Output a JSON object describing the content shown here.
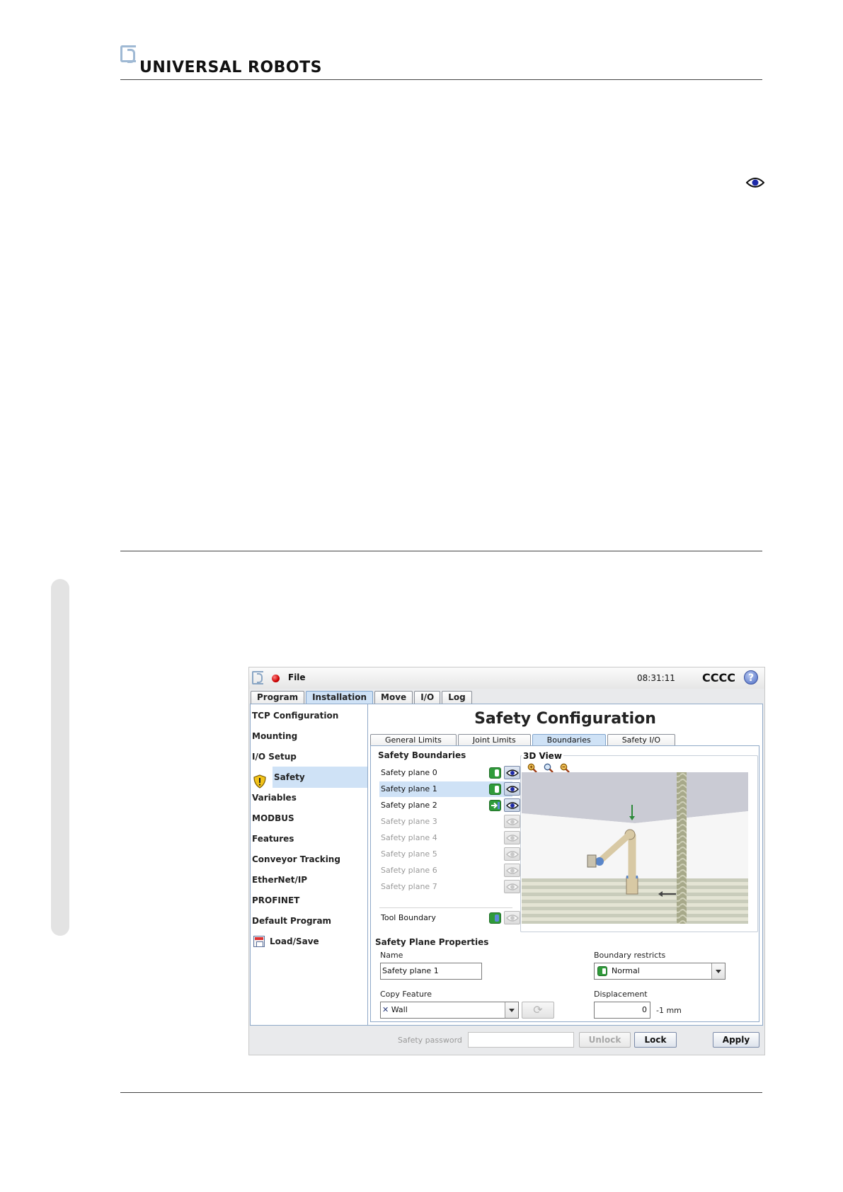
{
  "header": {
    "brand": "UNIVERSAL ROBOTS"
  },
  "app": {
    "menu_file": "File",
    "time": "08:31:11",
    "robot_name": "CCCC",
    "help_glyph": "?",
    "main_tabs": [
      {
        "label": "Program",
        "active": false
      },
      {
        "label": "Installation",
        "active": true
      },
      {
        "label": "Move",
        "active": false
      },
      {
        "label": "I/O",
        "active": false
      },
      {
        "label": "Log",
        "active": false
      }
    ],
    "left_nav": {
      "tcp": "TCP Configuration",
      "mounting": "Mounting",
      "io_setup": "I/O Setup",
      "safety": "Safety",
      "variables": "Variables",
      "modbus": "MODBUS",
      "features": "Features",
      "conveyor": "Conveyor Tracking",
      "ethernet": "EtherNet/IP",
      "profinet": "PROFINET",
      "default_program": "Default Program",
      "load_save": "Load/Save"
    },
    "title": "Safety Configuration",
    "sub_tabs": {
      "general": "General Limits",
      "joint": "Joint Limits",
      "boundaries": "Boundaries",
      "safety_io": "Safety I/O"
    },
    "boundaries": {
      "heading": "Safety Boundaries",
      "planes": [
        {
          "name": "Safety plane 0",
          "state": "normal",
          "visible": true
        },
        {
          "name": "Safety plane 1",
          "state": "normal",
          "visible": true,
          "selected": true
        },
        {
          "name": "Safety plane 2",
          "state": "trigger",
          "visible": true
        },
        {
          "name": "Safety plane 3",
          "state": "disabled",
          "visible": false
        },
        {
          "name": "Safety plane 4",
          "state": "disabled",
          "visible": false
        },
        {
          "name": "Safety plane 5",
          "state": "disabled",
          "visible": false
        },
        {
          "name": "Safety plane 6",
          "state": "disabled",
          "visible": false
        },
        {
          "name": "Safety plane 7",
          "state": "disabled",
          "visible": false
        }
      ],
      "tool_boundary": "Tool Boundary",
      "view_label": "3D View"
    },
    "properties": {
      "heading": "Safety Plane Properties",
      "name_label": "Name",
      "name_value": "Safety plane 1",
      "copy_label": "Copy Feature",
      "copy_value": "Wall",
      "restricts_label": "Boundary restricts",
      "restricts_value": "Normal",
      "displacement_label": "Displacement",
      "displacement_value": "0",
      "displacement_unit": "-1 mm"
    },
    "bottom": {
      "password_label": "Safety password",
      "unlock": "Unlock",
      "lock": "Lock",
      "apply": "Apply"
    }
  }
}
